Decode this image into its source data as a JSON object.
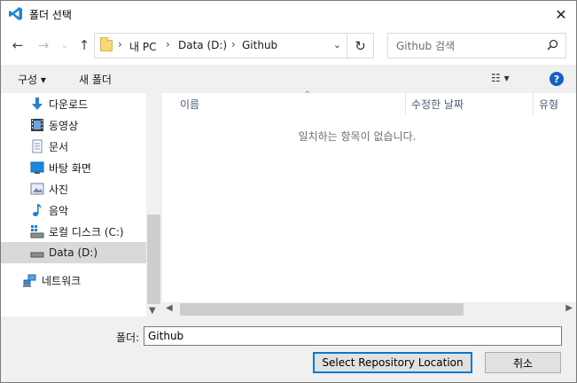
{
  "window": {
    "title": "폴더 선택",
    "close_glyph": "✕"
  },
  "nav": {
    "back_glyph": "←",
    "forward_glyph": "→",
    "recent_glyph": "⌄",
    "up_glyph": "↑",
    "breadcrumbs": [
      "내 PC",
      "Data (D:)",
      "Github"
    ],
    "crumb_separator": "›",
    "dropdown_glyph": "⌄",
    "refresh_glyph": "↻",
    "search_placeholder": "Github 검색",
    "search_glyph": "⚲"
  },
  "toolbar": {
    "organize_label": "구성 ▾",
    "new_folder_label": "새 폴더",
    "view_glyph": "☷ ▾",
    "help_glyph": "?"
  },
  "navpane": {
    "items": [
      {
        "label": "다운로드",
        "icon": "download-icon",
        "selected": false
      },
      {
        "label": "동영상",
        "icon": "video-icon",
        "selected": false
      },
      {
        "label": "문서",
        "icon": "document-icon",
        "selected": false
      },
      {
        "label": "바탕 화면",
        "icon": "desktop-icon",
        "selected": false
      },
      {
        "label": "사진",
        "icon": "pictures-icon",
        "selected": false
      },
      {
        "label": "음악",
        "icon": "music-icon",
        "selected": false
      },
      {
        "label": "로컬 디스크 (C:)",
        "icon": "drive-c-icon",
        "selected": false
      },
      {
        "label": "Data (D:)",
        "icon": "drive-icon",
        "selected": true
      },
      {
        "label": "네트워크",
        "icon": "network-icon",
        "selected": false
      }
    ]
  },
  "filelist": {
    "columns": [
      "이름",
      "수정한 날짜",
      "유형"
    ],
    "sort_glyph": "^",
    "empty_message": "일치하는 항목이 없습니다."
  },
  "footer": {
    "folder_label": "폴더:",
    "folder_value": "Github",
    "select_button": "Select Repository Location",
    "cancel_button": "취소"
  },
  "colors": {
    "accent": "#0078d7",
    "vscode_blue": "#1f85d4",
    "help_blue": "#1461c5"
  }
}
